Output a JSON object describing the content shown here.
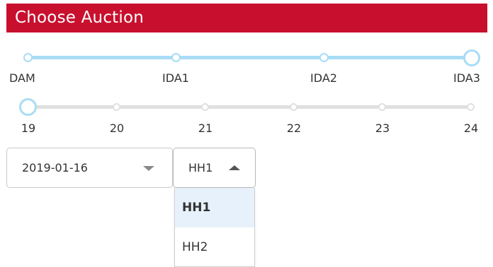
{
  "header": {
    "title": "Choose Auction"
  },
  "auction_slider": {
    "options": [
      "DAM",
      "IDA1",
      "IDA2",
      "IDA3"
    ],
    "selected": "IDA3",
    "selected_index": 3
  },
  "day_slider": {
    "options": [
      "19",
      "20",
      "21",
      "22",
      "23",
      "24"
    ],
    "selected": "19",
    "selected_index": 0
  },
  "date_select": {
    "value": "2019-01-16",
    "icon": "chevron-down-icon"
  },
  "hour_select": {
    "value": "HH1",
    "open": true,
    "icon": "chevron-up-icon",
    "options": [
      {
        "label": "HH1",
        "selected": true
      },
      {
        "label": "HH2",
        "selected": false
      }
    ]
  },
  "colors": {
    "header_bg": "#c8102e",
    "slider_active": "#a9dcf5",
    "slider_inactive": "#e0e0e0",
    "menu_selected_bg": "#e6f1fb"
  }
}
